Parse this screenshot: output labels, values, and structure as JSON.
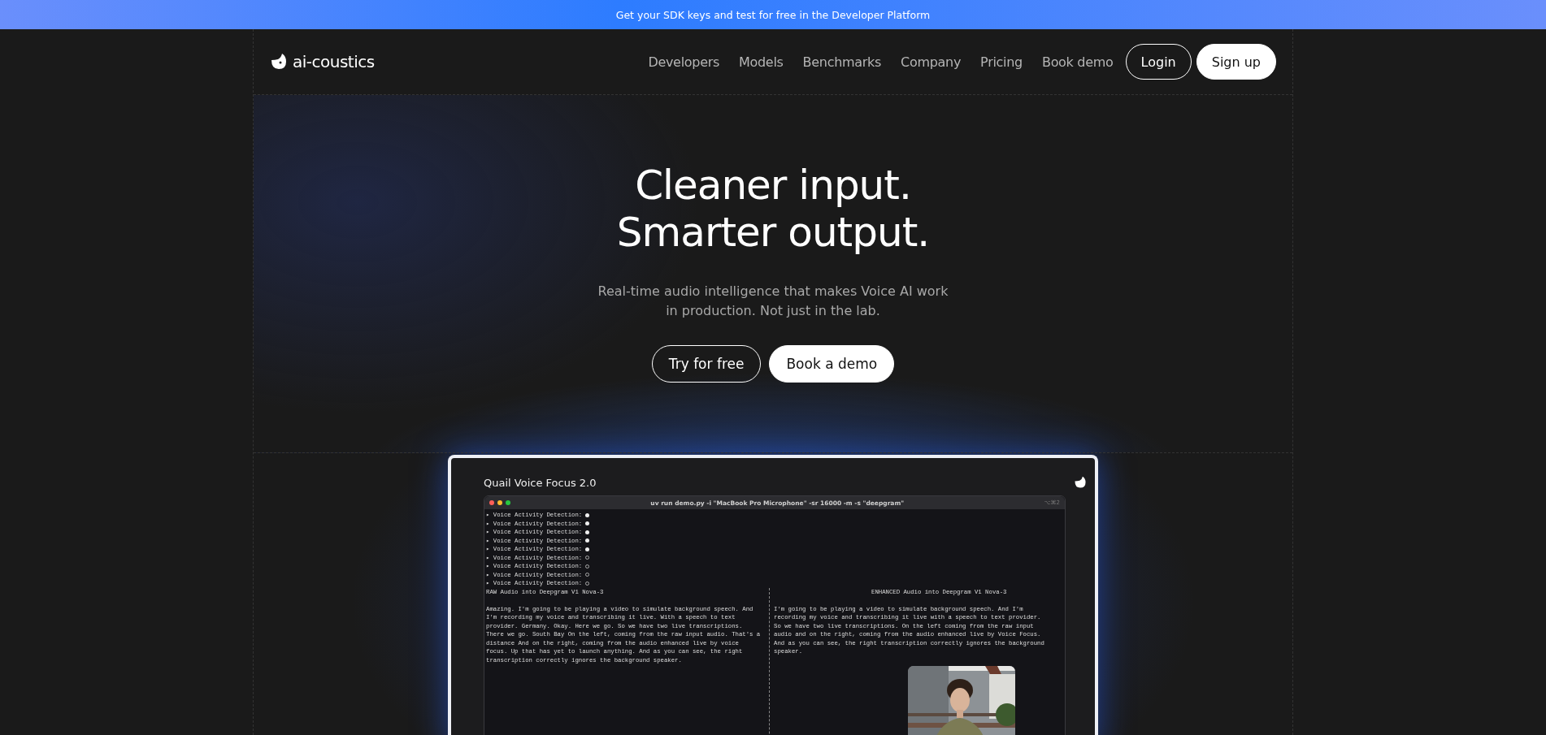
{
  "banner": {
    "text": "Get your SDK keys and test for free in the Developer Platform"
  },
  "nav": {
    "logo": "ai-coustics",
    "links": [
      "Developers",
      "Models",
      "Benchmarks",
      "Company",
      "Pricing",
      "Book demo"
    ],
    "login": "Login",
    "signup": "Sign up"
  },
  "hero": {
    "title_lines": [
      "Cleaner input.",
      "Smarter output."
    ],
    "subtitle": "Real-time audio intelligence that makes Voice AI work in production. Not just in the lab.",
    "primary_button": "Try for free",
    "secondary_button": "Book a demo"
  },
  "demo": {
    "title": "Quail Voice Focus 2.0",
    "terminal": {
      "command": "uv run demo.py -i \"MacBook Pro Microphone\" -sr 16000 -m  -s \"deepgram\"",
      "shortcut": "⌥⌘2",
      "vad_lines": [
        {
          "text": "▸ Voice Activity Detection:",
          "active": true
        },
        {
          "text": "▸ Voice Activity Detection:",
          "active": true
        },
        {
          "text": "▸ Voice Activity Detection:",
          "active": true
        },
        {
          "text": "▸ Voice Activity Detection:",
          "active": true
        },
        {
          "text": "▸ Voice Activity Detection:",
          "active": true
        },
        {
          "text": "▸ Voice Activity Detection:",
          "active": false
        },
        {
          "text": "▸ Voice Activity Detection:",
          "active": false
        },
        {
          "text": "▸ Voice Activity Detection:",
          "active": false
        },
        {
          "text": "▸ Voice Activity Detection:",
          "active": false
        }
      ],
      "left_heading": "RAW Audio into Deepgram V1 Nova-3",
      "right_heading": "ENHANCED Audio into Deepgram V1 Nova-3",
      "left_transcript": [
        "Amazing. I'm going to be playing a video to simulate background speech. And",
        "I'm recording my voice and transcribing it live. With a speech to text",
        "provider. Germany. Okay. Here we go. So we have two live transcriptions.",
        "There we go. South Bay On the left, coming from the raw input audio. That's a",
        "distance And on the right, coming from the audio enhanced live by voice",
        "focus. Up that has yet to launch anything. And as you can see, the right",
        "transcription correctly ignores the background speaker."
      ],
      "right_transcript": [
        "I'm going to be playing a video to simulate background speech. And I'm",
        "recording my voice and transcribing it live with a speech to text provider.",
        "So we have two live transcriptions. On the left coming from the raw input",
        "audio and on the right, coming from the audio enhanced live by Voice Focus.",
        "And as you can see, the right transcription correctly ignores the background",
        "speaker."
      ],
      "camera": {
        "kind": "picture"
      }
    }
  }
}
